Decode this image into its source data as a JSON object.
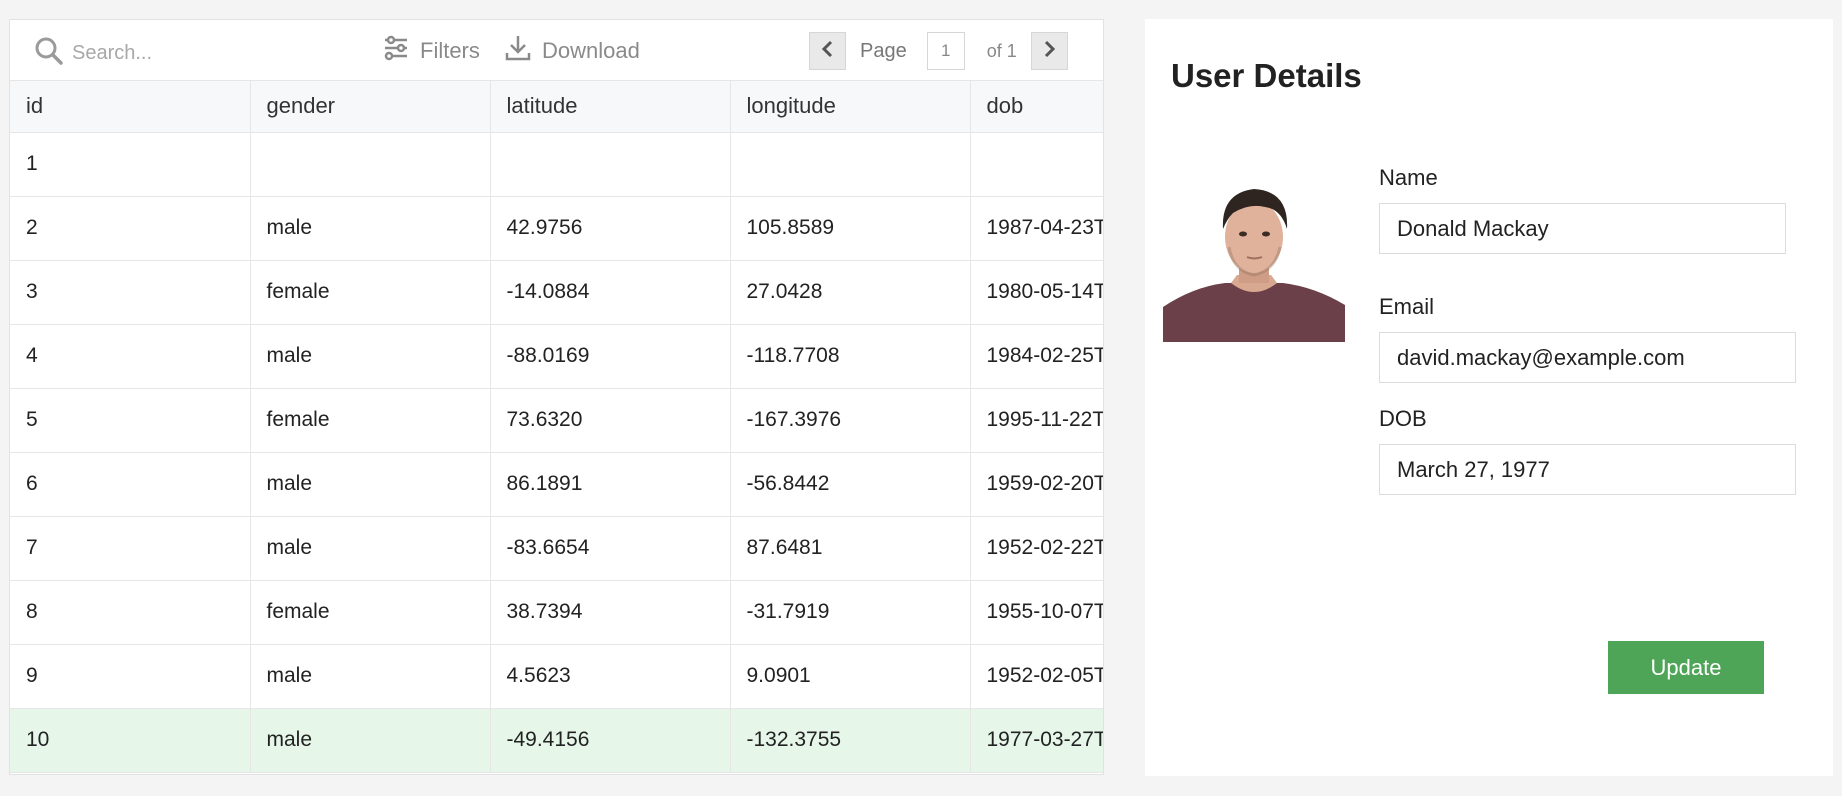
{
  "toolbar": {
    "search_placeholder": "Search...",
    "filters_label": "Filters",
    "download_label": "Download",
    "page_label": "Page",
    "page_value": "1",
    "page_of": "of 1"
  },
  "table": {
    "columns": [
      "id",
      "gender",
      "latitude",
      "longitude",
      "dob"
    ],
    "rows": [
      [
        "1",
        "",
        "",
        "",
        ""
      ],
      [
        "2",
        "male",
        "42.9756",
        "105.8589",
        "1987-04-23T"
      ],
      [
        "3",
        "female",
        "-14.0884",
        "27.0428",
        "1980-05-14T"
      ],
      [
        "4",
        "male",
        "-88.0169",
        "-118.7708",
        "1984-02-25T"
      ],
      [
        "5",
        "female",
        "73.6320",
        "-167.3976",
        "1995-11-22T"
      ],
      [
        "6",
        "male",
        "86.1891",
        "-56.8442",
        "1959-02-20T"
      ],
      [
        "7",
        "male",
        "-83.6654",
        "87.6481",
        "1952-02-22T"
      ],
      [
        "8",
        "female",
        "38.7394",
        "-31.7919",
        "1955-10-07T"
      ],
      [
        "9",
        "male",
        "4.5623",
        "9.0901",
        "1952-02-05T"
      ],
      [
        "10",
        "male",
        "-49.4156",
        "-132.3755",
        "1977-03-27T"
      ]
    ],
    "selected_row": 9
  },
  "details": {
    "title": "User Details",
    "name_label": "Name",
    "name_value": "Donald Mackay",
    "email_label": "Email",
    "email_value": "david.mackay@example.com",
    "dob_label": "DOB",
    "dob_value": "March 27, 1977",
    "update_label": "Update"
  },
  "colors": {
    "accent": "#4ea457",
    "selected_row_bg": "#e6f7ea"
  }
}
